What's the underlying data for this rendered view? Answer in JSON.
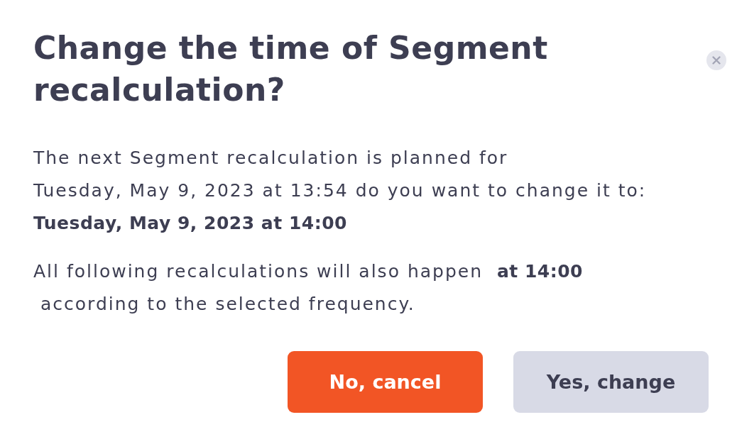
{
  "dialog": {
    "title": "Change the time of Segment recalculation?",
    "message": [
      "The next Segment recalculation is planned for",
      "Tuesday, May 9, 2023 at 13:54 do you want to change it to:",
      "**Tuesday, May 9, 2023 at 14:00**"
    ],
    "note": [
      "All following recalculations will also happen  **at 14:00**",
      " according to the selected frequency."
    ],
    "buttons": [
      {
        "label": "No, cancel",
        "kind": "primary"
      },
      {
        "label": "Yes, change",
        "kind": "secondary"
      }
    ]
  }
}
